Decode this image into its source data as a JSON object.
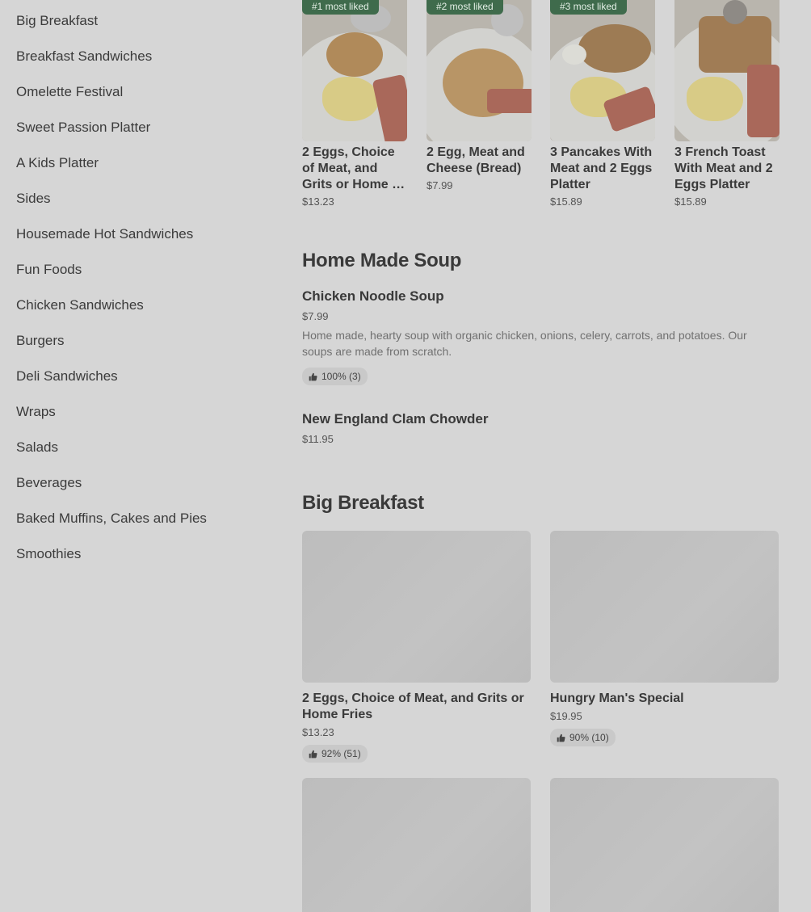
{
  "sidebar": {
    "categories": [
      "Big Breakfast",
      "Breakfast Sandwiches",
      "Omelette Festival",
      "Sweet Passion Platter",
      "A Kids Platter",
      "Sides",
      "Housemade Hot Sandwiches",
      "Fun Foods",
      "Chicken Sandwiches",
      "Burgers",
      "Deli Sandwiches",
      "Wraps",
      "Salads",
      "Beverages",
      "Baked Muffins, Cakes and Pies",
      "Smoothies"
    ]
  },
  "most_liked": [
    {
      "badge": "#1 most liked",
      "name": "2 Eggs, Choice of Meat, and Grits or Home …",
      "price": "$13.23"
    },
    {
      "badge": "#2 most liked",
      "name": "2 Egg, Meat and Cheese (Bread)",
      "price": "$7.99"
    },
    {
      "badge": "#3 most liked",
      "name": "3 Pancakes With Meat and 2 Eggs Platter",
      "price": "$15.89"
    },
    {
      "badge": "",
      "name": "3 French Toast With Meat and 2 Eggs Platter",
      "price": "$15.89"
    }
  ],
  "soup_section": {
    "title": "Home Made Soup",
    "items": [
      {
        "name": "Chicken Noodle Soup",
        "price": "$7.99",
        "description": "Home made, hearty soup with organic chicken, onions, celery, carrots, and potatoes. Our soups are made from scratch.",
        "rating": "100% (3)"
      },
      {
        "name": "New England Clam Chowder",
        "price": "$11.95"
      }
    ]
  },
  "big_breakfast_section": {
    "title": "Big Breakfast",
    "items": [
      {
        "name": "2 Eggs, Choice of Meat, and Grits or Home Fries",
        "price": "$13.23",
        "rating": "92% (51)"
      },
      {
        "name": "Hungry Man's Special",
        "price": "$19.95",
        "rating": "90% (10)"
      }
    ]
  },
  "icons": {
    "rating": "thumbs-up-icon"
  },
  "colors": {
    "badge_bg": "#3f6b4c",
    "overlay_bg": "#d6d6d6"
  }
}
